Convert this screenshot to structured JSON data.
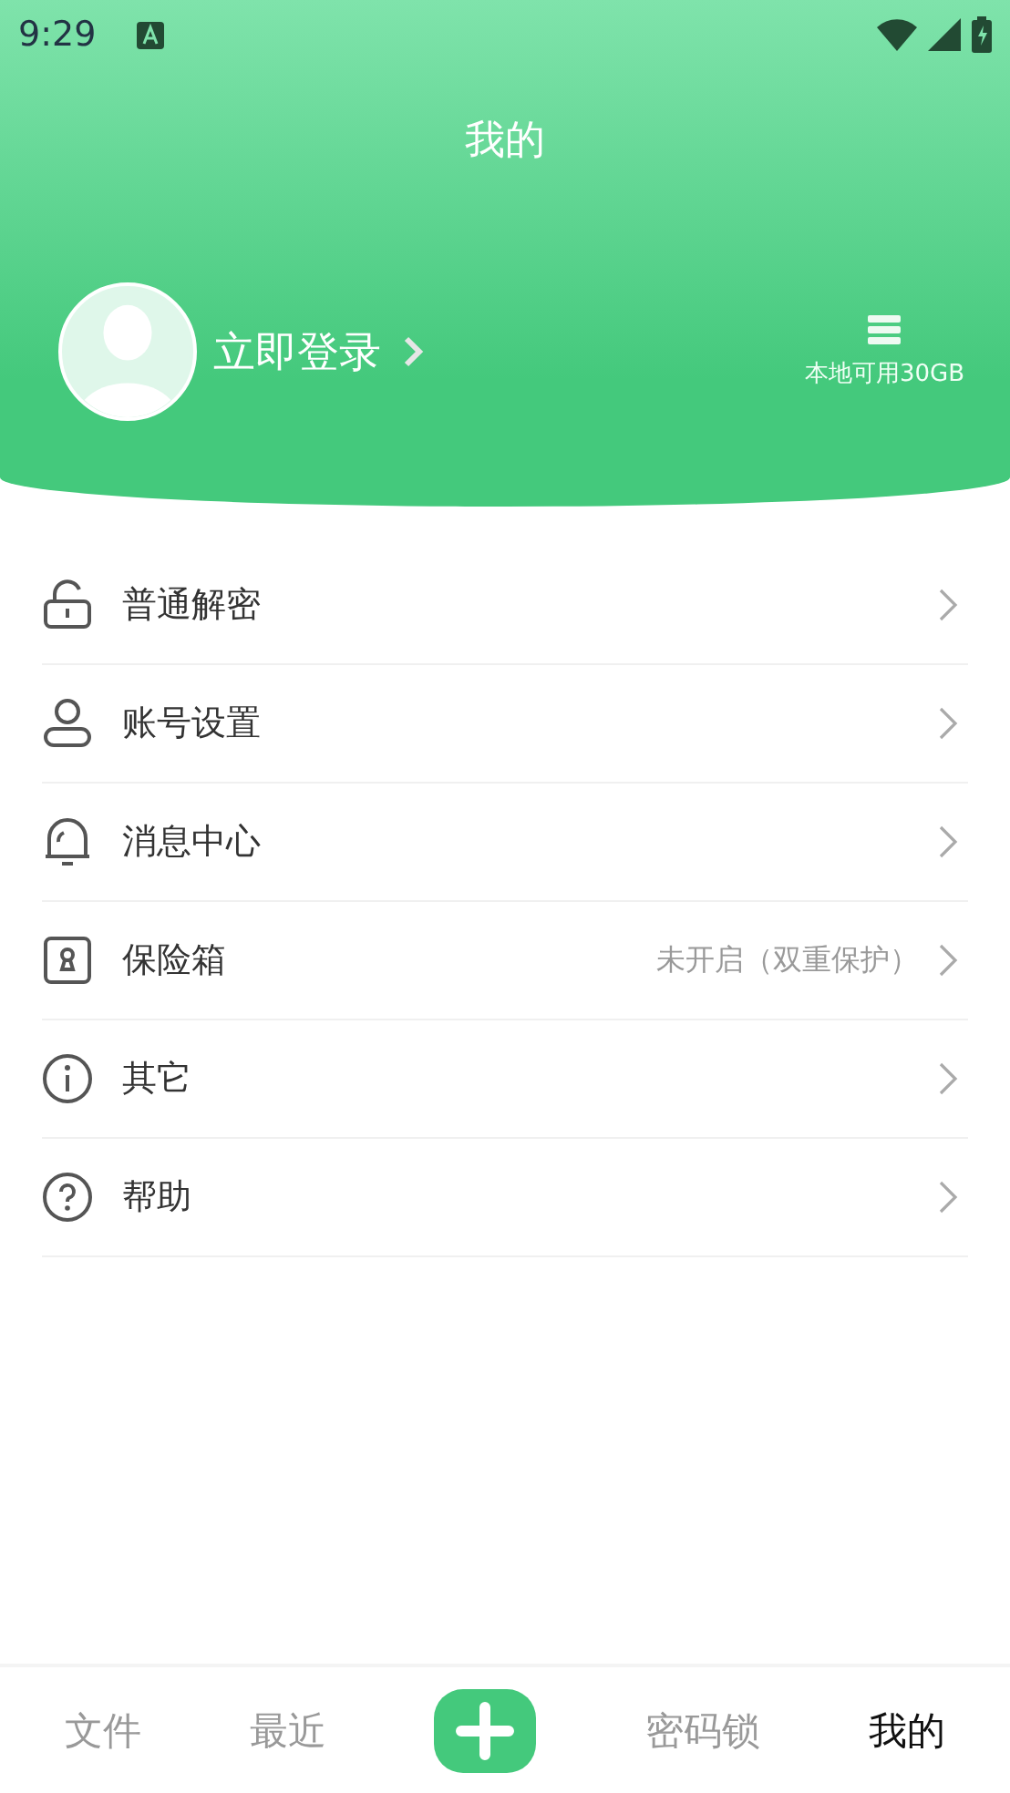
{
  "status_bar": {
    "time": "9:29"
  },
  "header": {
    "title": "我的",
    "login": "立即登录",
    "storage": "本地可用30GB"
  },
  "menu": [
    {
      "kind": "unlock",
      "label": "普通解密"
    },
    {
      "kind": "user",
      "label": "账号设置"
    },
    {
      "kind": "bell",
      "label": "消息中心"
    },
    {
      "kind": "safe",
      "label": "保险箱",
      "value": "未开启（双重保护）"
    },
    {
      "kind": "info",
      "label": "其它"
    },
    {
      "kind": "help",
      "label": "帮助"
    }
  ],
  "bottom_nav": [
    {
      "kind": "tab",
      "label": "文件",
      "selected": false
    },
    {
      "kind": "tab",
      "label": "最近",
      "selected": false
    },
    {
      "kind": "add"
    },
    {
      "kind": "tab",
      "label": "密码锁",
      "selected": false
    },
    {
      "kind": "tab",
      "label": "我的",
      "selected": true
    }
  ]
}
